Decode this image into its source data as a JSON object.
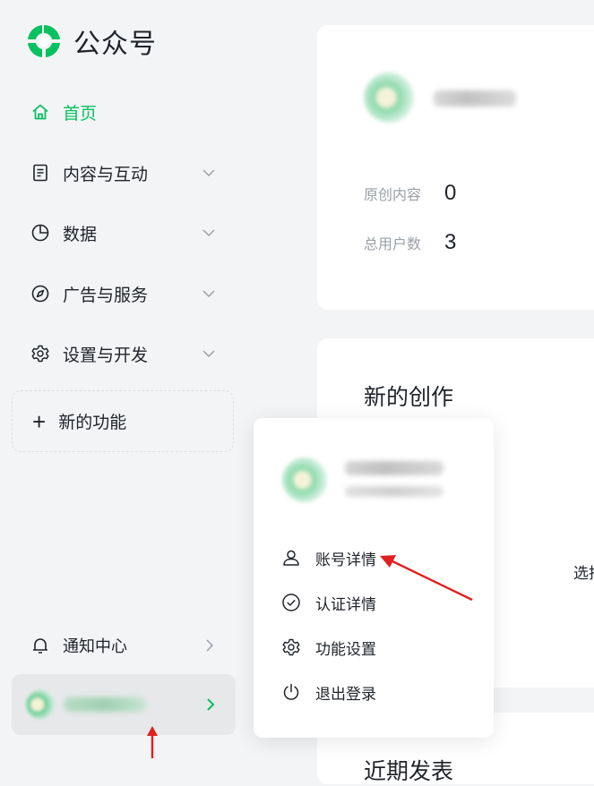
{
  "app": {
    "title": "公众号",
    "brand_color": "#07c160"
  },
  "sidebar": {
    "items": [
      {
        "label": "首页",
        "icon": "home-icon",
        "active": true
      },
      {
        "label": "内容与互动",
        "icon": "document-icon"
      },
      {
        "label": "数据",
        "icon": "pie-chart-icon"
      },
      {
        "label": "广告与服务",
        "icon": "compass-icon"
      },
      {
        "label": "设置与开发",
        "icon": "gear-icon"
      }
    ],
    "new_feature_label": "新的功能",
    "notify_label": "通知中心"
  },
  "overview": {
    "stats": [
      {
        "label": "原创内容",
        "value": "0"
      },
      {
        "label": "总用户数",
        "value": "3"
      }
    ]
  },
  "creation": {
    "title": "新的创作",
    "select_text": "选择"
  },
  "recent": {
    "title": "近期发表"
  },
  "account_menu": {
    "items": [
      {
        "label": "账号详情",
        "icon": "user-icon"
      },
      {
        "label": "认证详情",
        "icon": "check-circle-icon"
      },
      {
        "label": "功能设置",
        "icon": "gear-icon"
      },
      {
        "label": "退出登录",
        "icon": "power-icon"
      }
    ]
  },
  "annotation_color": "#e02020"
}
